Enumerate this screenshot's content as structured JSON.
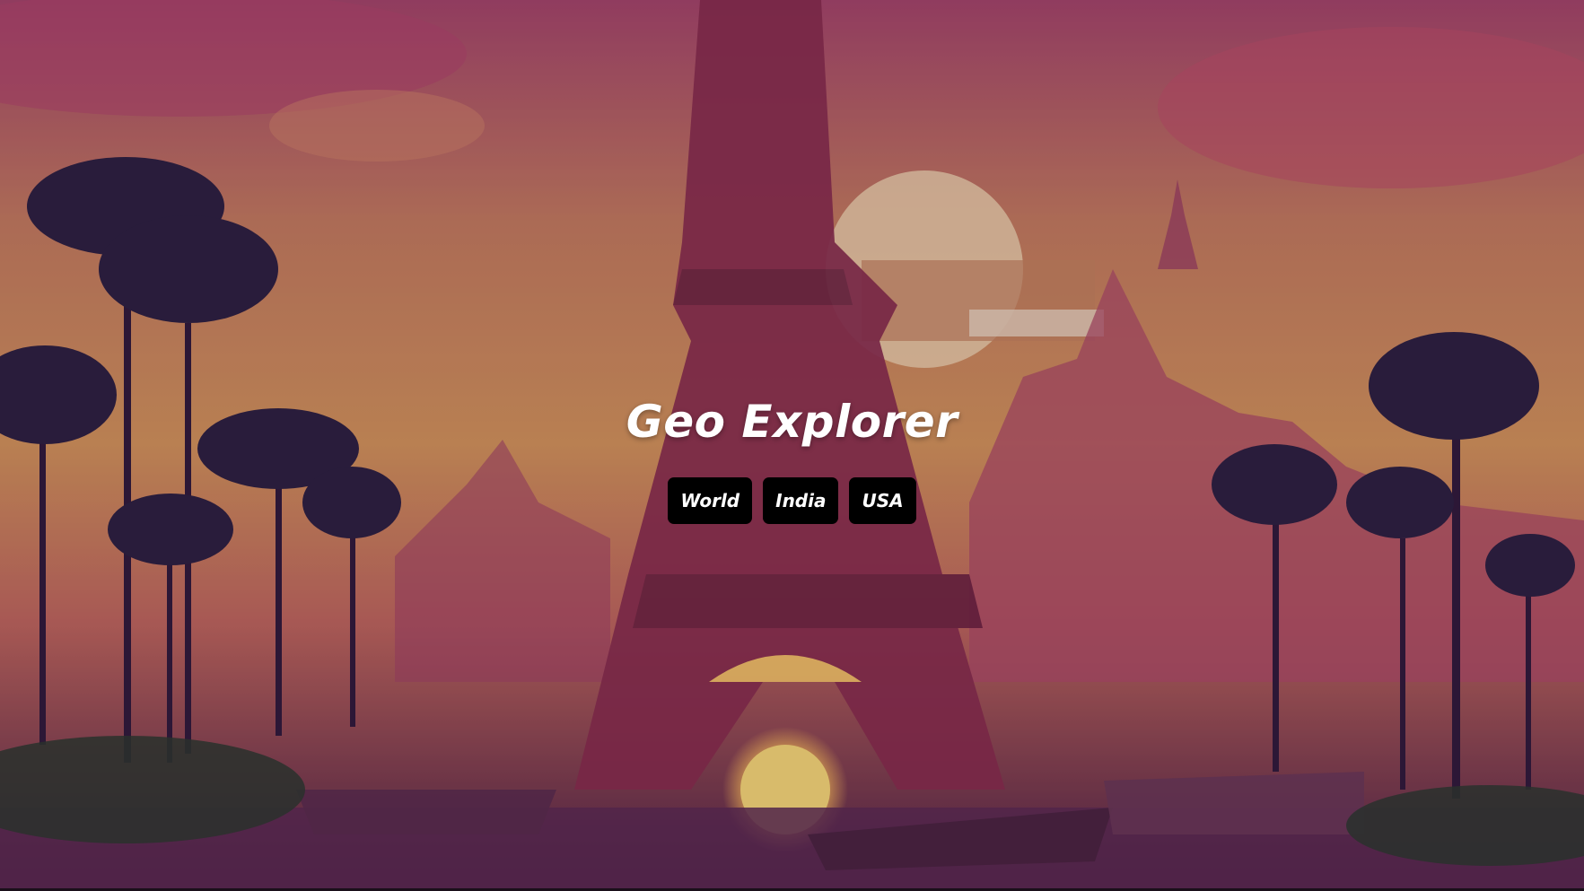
{
  "hero": {
    "title": "Geo Explorer",
    "background_image": "sunset-eiffel-tower-palm-trees-illustration"
  },
  "nav": {
    "items": [
      {
        "label": "World"
      },
      {
        "label": "India"
      },
      {
        "label": "USA"
      }
    ]
  },
  "colors": {
    "button_bg": "#000000",
    "button_text": "#ffffff",
    "title_text": "#ffffff"
  }
}
